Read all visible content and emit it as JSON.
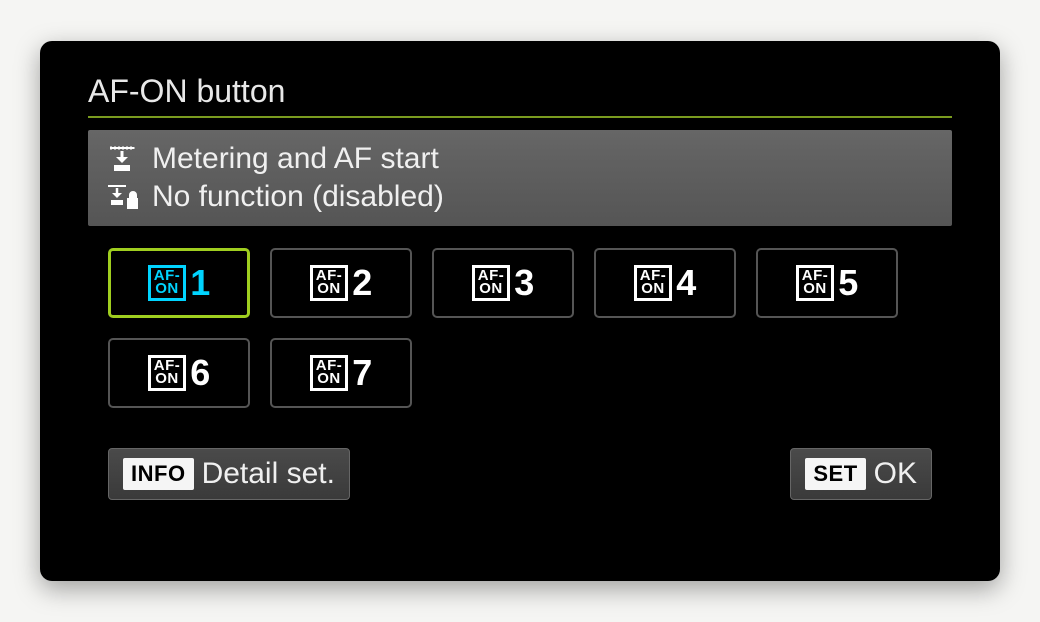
{
  "title": "AF-ON button",
  "info": {
    "line1": "Metering and AF start",
    "line2": "No function (disabled)"
  },
  "presets": [
    {
      "label_top": "AF-",
      "label_bot": "ON",
      "num": "1",
      "selected": true
    },
    {
      "label_top": "AF-",
      "label_bot": "ON",
      "num": "2",
      "selected": false
    },
    {
      "label_top": "AF-",
      "label_bot": "ON",
      "num": "3",
      "selected": false
    },
    {
      "label_top": "AF-",
      "label_bot": "ON",
      "num": "4",
      "selected": false
    },
    {
      "label_top": "AF-",
      "label_bot": "ON",
      "num": "5",
      "selected": false
    },
    {
      "label_top": "AF-",
      "label_bot": "ON",
      "num": "6",
      "selected": false
    },
    {
      "label_top": "AF-",
      "label_bot": "ON",
      "num": "7",
      "selected": false
    }
  ],
  "footer": {
    "info_badge": "INFO",
    "info_label": "Detail set.",
    "set_badge": "SET",
    "set_label": "OK"
  }
}
